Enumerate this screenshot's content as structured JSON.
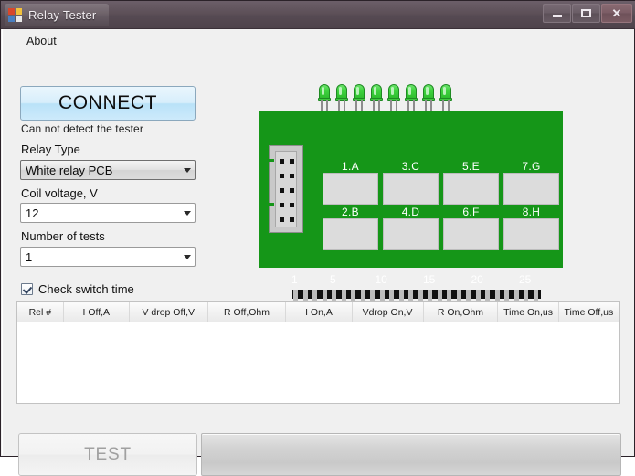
{
  "window": {
    "title": "Relay Tester",
    "app_icon": "app-window-icon",
    "buttons": {
      "minimize": "minimize-icon",
      "maximize": "maximize-icon",
      "close": "✕"
    }
  },
  "menu": {
    "items": [
      {
        "label": "About"
      }
    ]
  },
  "controls": {
    "connect_label": "CONNECT",
    "status_text": "Can not detect the tester",
    "relay_type": {
      "label": "Relay Type",
      "value": "White relay PCB"
    },
    "coil_voltage": {
      "label": "Coil voltage,  V",
      "value": "12"
    },
    "number_of_tests": {
      "label": "Number of tests",
      "value": "1"
    },
    "check_switch_time": {
      "label": "Check switch time",
      "checked": true
    }
  },
  "pcb": {
    "board_color": "#159618",
    "led_count": 8,
    "led_color": "#3fd23f",
    "connector": {
      "name": "idc-connector",
      "rows": 5,
      "cols": 2,
      "pins": 10
    },
    "relay_pads": [
      "1.A",
      "3.C",
      "5.E",
      "7.G",
      "2.B",
      "4.D",
      "6.F",
      "8.H"
    ],
    "pin_header": {
      "pin_count": 26,
      "scale_labels": [
        "1",
        "5",
        "10",
        "15",
        "20",
        "25"
      ]
    }
  },
  "results_table": {
    "columns": [
      "Rel #",
      "I Off,A",
      "V drop Off,V",
      "R Off,Ohm",
      "I On,A",
      "Vdrop On,V",
      "R On,Ohm",
      "Time On,us",
      "Time Off,us"
    ],
    "rows": []
  },
  "footer": {
    "test_label": "TEST",
    "progress_value": 0
  }
}
